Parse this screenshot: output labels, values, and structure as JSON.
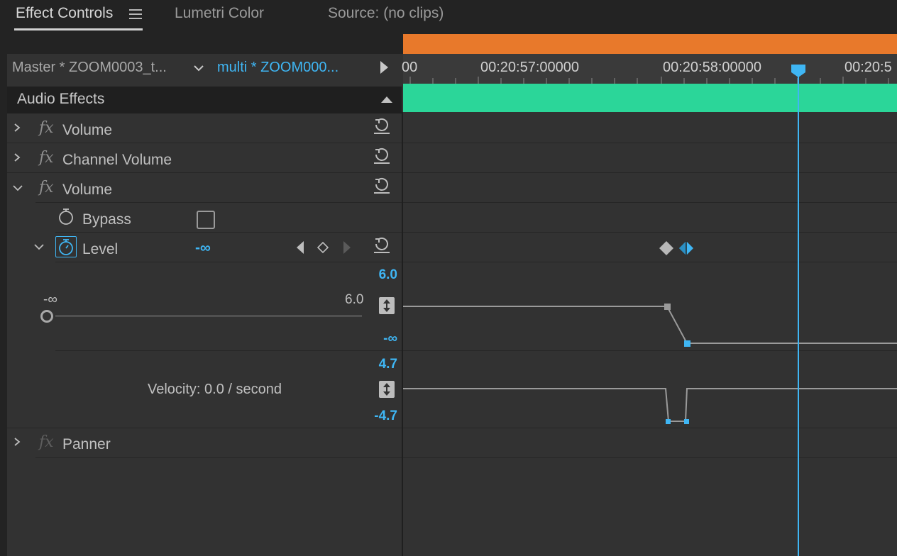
{
  "tabs": [
    {
      "label": "Effect Controls",
      "active": true
    },
    {
      "label": "Lumetri Color",
      "active": false
    },
    {
      "label": "Source: (no clips)",
      "active": false
    }
  ],
  "header": {
    "master_label": "Master * ZOOM0003_t...",
    "clip_label": "multi * ZOOM000..."
  },
  "effects_section": {
    "title": "Audio Effects",
    "rows": [
      {
        "label": "Volume",
        "expanded": false
      },
      {
        "label": "Channel Volume",
        "expanded": false
      },
      {
        "label": "Volume",
        "expanded": true
      },
      {
        "label": "Bypass"
      },
      {
        "label": "Level",
        "value": "-∞"
      },
      {
        "label": "Panner",
        "expanded": false
      }
    ]
  },
  "level_graph": {
    "value_max": "6.0",
    "value_min": "-∞",
    "slider_min": "-∞",
    "slider_max": "6.0",
    "velocity_max": "4.7",
    "velocity_min": "-4.7",
    "velocity_text": "Velocity: 0.0 / second"
  },
  "timeline": {
    "ruler_labels": [
      "00",
      "00:20:57:00000",
      "00:20:58:00000",
      "00:20:5"
    ]
  },
  "colors": {
    "accent_blue": "#3fb6f4",
    "clip_orange": "#e8792b",
    "clip_green": "#2bd699",
    "panel_bg": "#323232"
  }
}
